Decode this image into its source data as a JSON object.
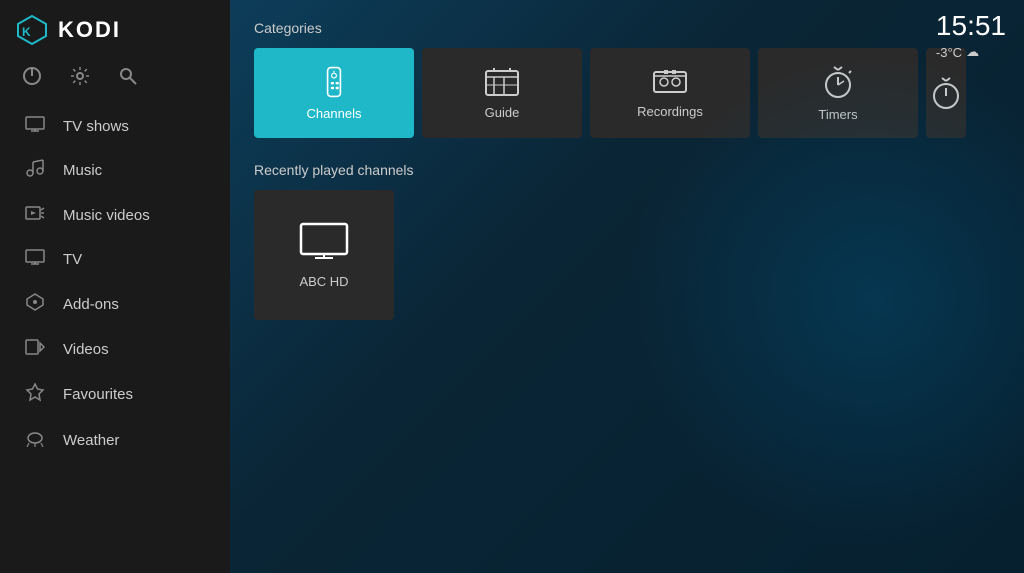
{
  "app": {
    "title": "KODI"
  },
  "clock": {
    "time": "15:51",
    "temperature": "-3°C",
    "weather_icon": "☁"
  },
  "sidebar": {
    "controls": [
      {
        "name": "power-button",
        "icon": "⏻",
        "label": "Power"
      },
      {
        "name": "settings-button",
        "icon": "⚙",
        "label": "Settings"
      },
      {
        "name": "search-button",
        "icon": "🔍",
        "label": "Search"
      }
    ],
    "nav_items": [
      {
        "name": "tv-shows",
        "label": "TV shows",
        "icon": "🖥"
      },
      {
        "name": "music",
        "label": "Music",
        "icon": "🎧"
      },
      {
        "name": "music-videos",
        "label": "Music videos",
        "icon": "🎵"
      },
      {
        "name": "tv",
        "label": "TV",
        "icon": "📺"
      },
      {
        "name": "add-ons",
        "label": "Add-ons",
        "icon": "⬡"
      },
      {
        "name": "videos",
        "label": "Videos",
        "icon": "🎬"
      },
      {
        "name": "favourites",
        "label": "Favourites",
        "icon": "★"
      },
      {
        "name": "weather",
        "label": "Weather",
        "icon": "🌩"
      }
    ]
  },
  "main": {
    "categories_label": "Categories",
    "categories": [
      {
        "id": "channels",
        "label": "Channels",
        "active": true
      },
      {
        "id": "guide",
        "label": "Guide",
        "active": false
      },
      {
        "id": "recordings",
        "label": "Recordings",
        "active": false
      },
      {
        "id": "timers",
        "label": "Timers",
        "active": false
      },
      {
        "id": "timers2",
        "label": "Tim...",
        "active": false
      }
    ],
    "recently_played_label": "Recently played channels",
    "channels": [
      {
        "id": "abc-hd",
        "label": "ABC HD"
      }
    ]
  }
}
